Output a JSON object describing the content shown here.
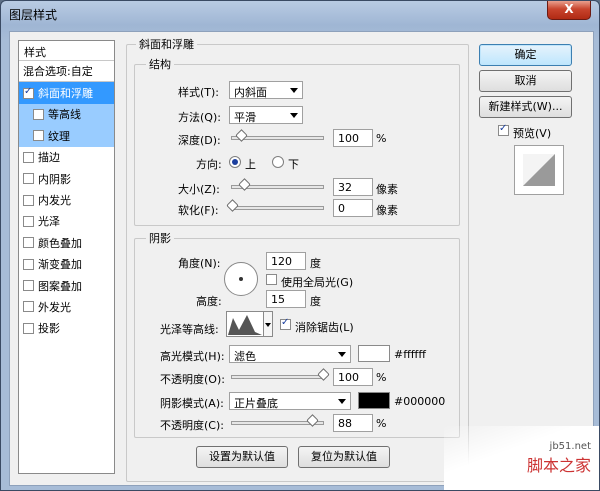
{
  "window": {
    "title": "图层样式",
    "close_label": "X"
  },
  "sidebar": {
    "header": "样式",
    "blend_options": "混合选项:自定",
    "items": [
      {
        "label": "斜面和浮雕",
        "checked": true
      },
      {
        "label": "等高线",
        "checked": false
      },
      {
        "label": "纹理",
        "checked": false
      },
      {
        "label": "描边",
        "checked": false
      },
      {
        "label": "内阴影",
        "checked": false
      },
      {
        "label": "内发光",
        "checked": false
      },
      {
        "label": "光泽",
        "checked": false
      },
      {
        "label": "颜色叠加",
        "checked": false
      },
      {
        "label": "渐变叠加",
        "checked": false
      },
      {
        "label": "图案叠加",
        "checked": false
      },
      {
        "label": "外发光",
        "checked": false
      },
      {
        "label": "投影",
        "checked": false
      }
    ]
  },
  "bevel": {
    "group_title": "斜面和浮雕",
    "structure": {
      "title": "结构",
      "style_label": "样式(T):",
      "style_value": "内斜面",
      "technique_label": "方法(Q):",
      "technique_value": "平滑",
      "depth_label": "深度(D):",
      "depth_value": "100",
      "depth_unit": "%",
      "depth_fraction": 0.1,
      "direction_label": "方向:",
      "direction_up": "上",
      "direction_down": "下",
      "size_label": "大小(Z):",
      "size_value": "32",
      "size_unit": "像素",
      "size_fraction": 0.13,
      "soften_label": "软化(F):",
      "soften_value": "0",
      "soften_unit": "像素",
      "soften_fraction": 0.0
    },
    "shading": {
      "title": "阴影",
      "angle_label": "角度(N):",
      "angle_value": "120",
      "angle_unit": "度",
      "global_light_label": "使用全局光(G)",
      "altitude_label": "高度:",
      "altitude_value": "15",
      "altitude_unit": "度",
      "gloss_label": "光泽等高线:",
      "antialias_label": "消除锯齿(L)",
      "highlight_mode_label": "高光模式(H):",
      "highlight_mode_value": "滤色",
      "highlight_color": "#ffffff",
      "highlight_color_text": "#ffffff",
      "highlight_opacity_label": "不透明度(O):",
      "highlight_opacity_value": "100",
      "highlight_opacity_unit": "%",
      "highlight_opacity_fraction": 1.0,
      "shadow_mode_label": "阴影模式(A):",
      "shadow_mode_value": "正片叠底",
      "shadow_color": "#000000",
      "shadow_color_text": "#000000",
      "shadow_opacity_label": "不透明度(C):",
      "shadow_opacity_value": "88",
      "shadow_opacity_unit": "%",
      "shadow_opacity_fraction": 0.88
    },
    "make_default": "设置为默认值",
    "reset_default": "复位为默认值"
  },
  "buttons": {
    "ok": "确定",
    "cancel": "取消",
    "new_style": "新建样式(W)...",
    "preview_label": "预览(V)"
  },
  "watermark": {
    "url": "jb51.net",
    "name": "脚本之家"
  }
}
